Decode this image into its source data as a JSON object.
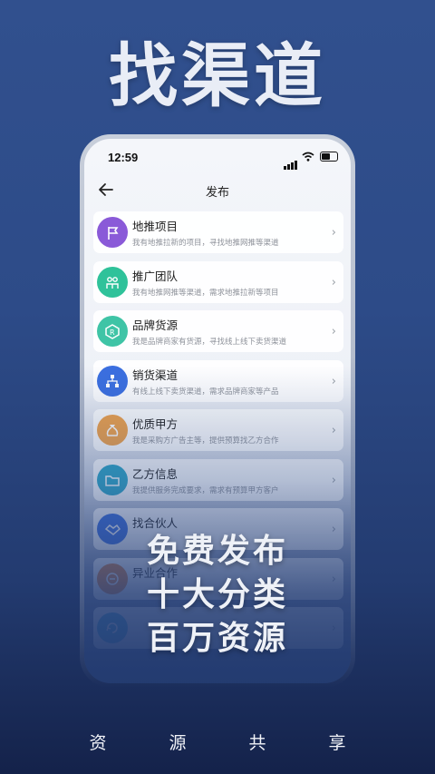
{
  "hero_title": "找渠道",
  "status_bar": {
    "time": "12:59"
  },
  "nav": {
    "title": "发布"
  },
  "items": [
    {
      "title": "地推项目",
      "desc": "我有地推拉新的项目，寻找地推网推等渠道",
      "icon": "flag-icon",
      "color": "#8a5ad8"
    },
    {
      "title": "推广团队",
      "desc": "我有地推网推等渠道，需求地推拉新等项目",
      "icon": "team-icon",
      "color": "#2fc29a"
    },
    {
      "title": "品牌货源",
      "desc": "我是品牌商家有货源，寻找线上线下卖货渠道",
      "icon": "brand-icon",
      "color": "#3fc4a6"
    },
    {
      "title": "销货渠道",
      "desc": "有线上线下卖货渠道，需求品牌商家等产品",
      "icon": "network-icon",
      "color": "#3b6fe0"
    },
    {
      "title": "优质甲方",
      "desc": "我是采购方广告主等，提供预算找乙方合作",
      "icon": "moneybag-icon",
      "color": "#f0a24a"
    },
    {
      "title": "乙方信息",
      "desc": "我提供服务完成要求，需求有预算甲方客户",
      "icon": "folder-icon",
      "color": "#2fa7c7"
    },
    {
      "title": "找合伙人",
      "desc": "",
      "icon": "handshake-icon",
      "color": "#3b6fe0"
    },
    {
      "title": "异业合作",
      "desc": "",
      "icon": "cooperation-icon",
      "color": "#e4823d"
    },
    {
      "title": "",
      "desc": "",
      "icon": "cycle-icon",
      "color": "#3fa8d8"
    }
  ],
  "promo": [
    "免费发布",
    "十大分类",
    "百万资源"
  ],
  "footer": [
    "资",
    "源",
    "共",
    "享"
  ]
}
